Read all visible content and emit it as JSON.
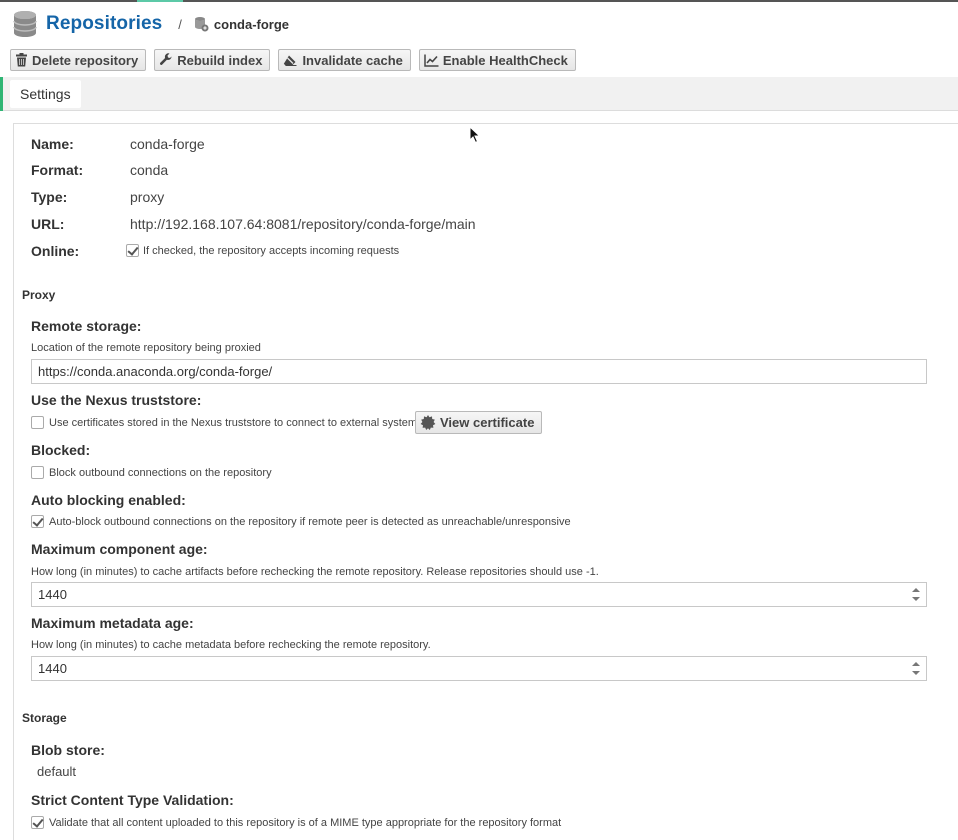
{
  "header": {
    "title": "Repositories",
    "separator": "/",
    "current": "conda-forge"
  },
  "toolbar": {
    "delete_label": "Delete repository",
    "rebuild_label": "Rebuild index",
    "invalidate_label": "Invalidate cache",
    "healthcheck_label": "Enable HealthCheck"
  },
  "tabs": {
    "settings": "Settings"
  },
  "summary": {
    "name_label": "Name:",
    "name_value": "conda-forge",
    "format_label": "Format:",
    "format_value": "conda",
    "type_label": "Type:",
    "type_value": "proxy",
    "url_label": "URL:",
    "url_value": "http://192.168.107.64:8081/repository/conda-forge/main",
    "online_label": "Online:",
    "online_help": "If checked, the repository accepts incoming requests",
    "online_checked": true
  },
  "proxy": {
    "section": "Proxy",
    "remote_label": "Remote storage:",
    "remote_help": "Location of the remote repository being proxied",
    "remote_value": "https://conda.anaconda.org/conda-forge/",
    "truststore_label": "Use the Nexus truststore:",
    "truststore_help": "Use certificates stored in the Nexus truststore to connect to external systems",
    "truststore_checked": false,
    "view_cert_label": "View certificate",
    "blocked_label": "Blocked:",
    "blocked_help": "Block outbound connections on the repository",
    "blocked_checked": false,
    "autoblock_label": "Auto blocking enabled:",
    "autoblock_help": "Auto-block outbound connections on the repository if remote peer is detected as unreachable/unresponsive",
    "autoblock_checked": true,
    "max_component_label": "Maximum component age:",
    "max_component_help": "How long (in minutes) to cache artifacts before rechecking the remote repository. Release repositories should use -1.",
    "max_component_value": "1440",
    "max_metadata_label": "Maximum metadata age:",
    "max_metadata_help": "How long (in minutes) to cache metadata before rechecking the remote repository.",
    "max_metadata_value": "1440"
  },
  "storage": {
    "section": "Storage",
    "blob_label": "Blob store:",
    "blob_value": "default",
    "strict_label": "Strict Content Type Validation:",
    "strict_help": "Validate that all content uploaded to this repository is of a MIME type appropriate for the repository format",
    "strict_checked": true
  }
}
